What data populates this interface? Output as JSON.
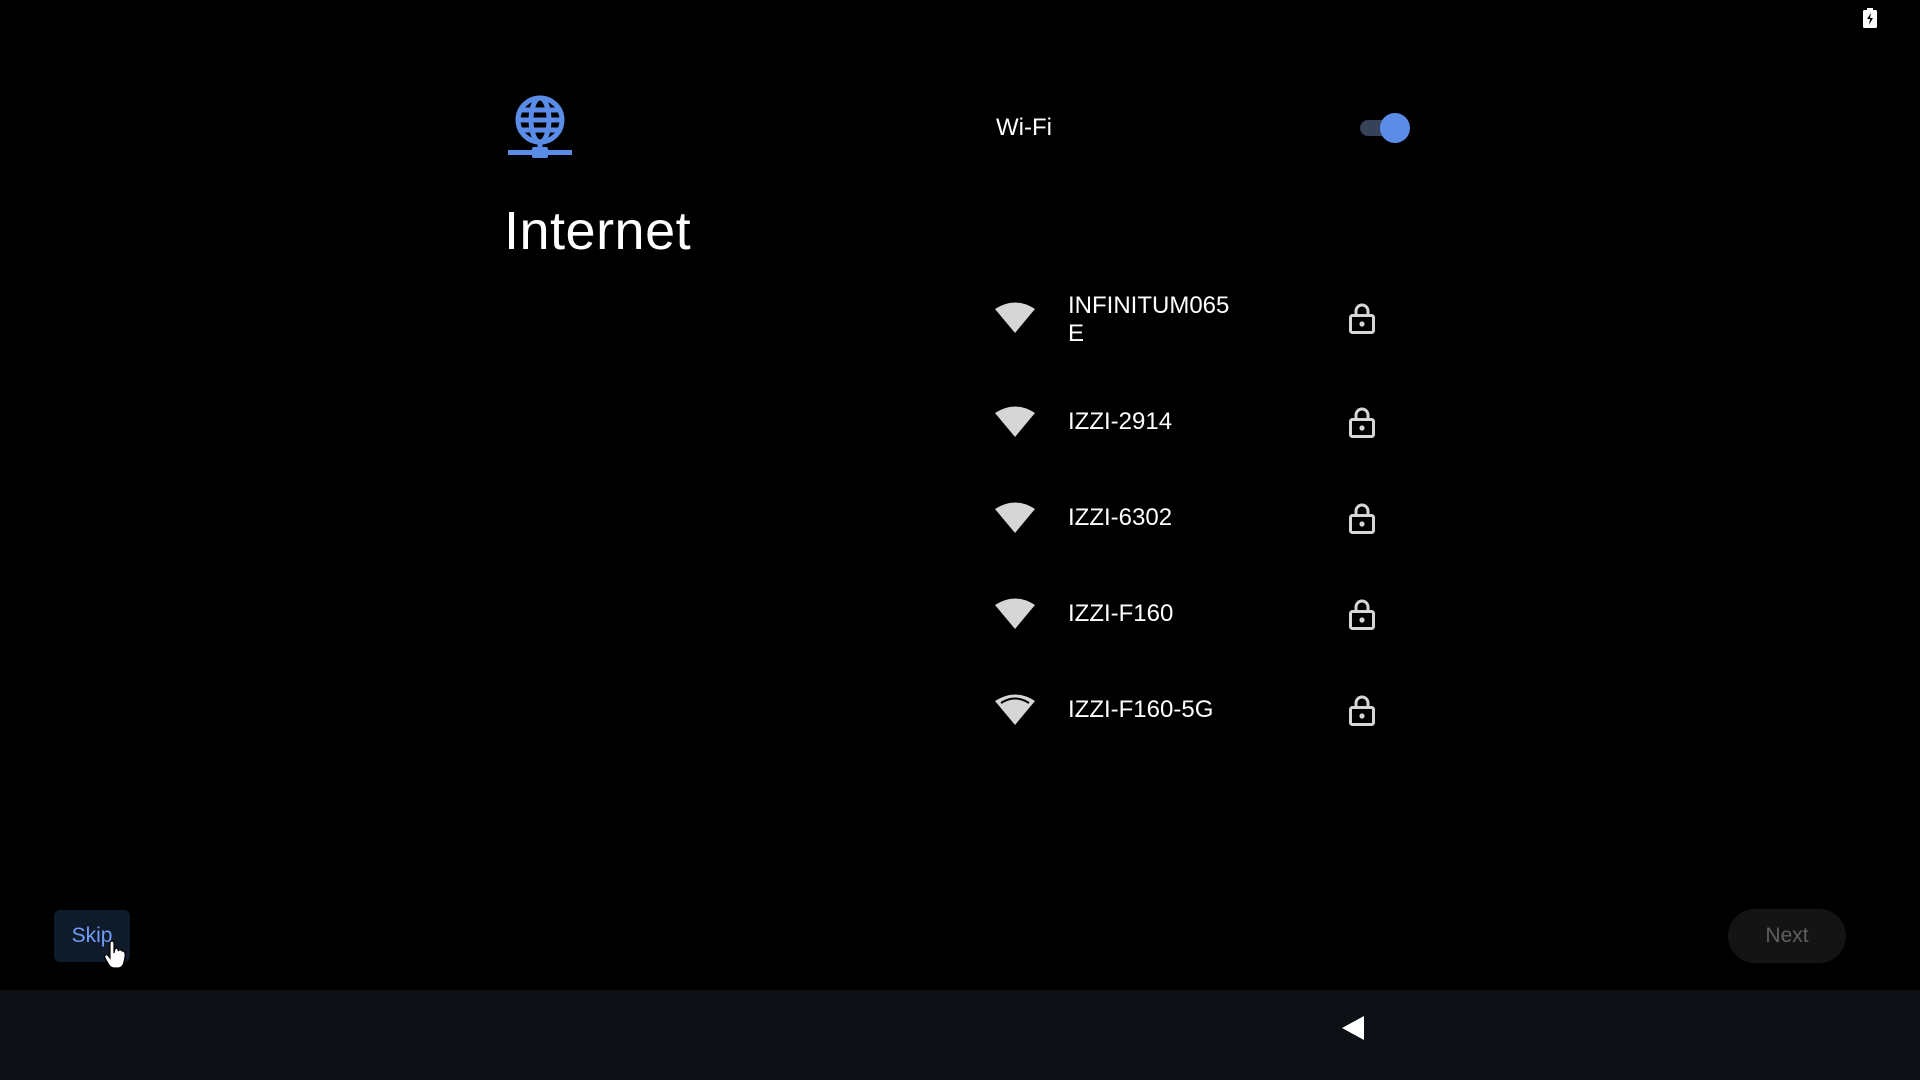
{
  "status_bar": {
    "icons": [
      "battery-icon"
    ]
  },
  "header": {
    "icon": "globe-network-icon",
    "title": "Internet"
  },
  "wifi": {
    "label": "Wi-Fi",
    "enabled": true,
    "networks": [
      {
        "ssid": "INFINITUM065E",
        "signal_icon": "wifi-signal-icon",
        "secured": true,
        "lock_icon": "lock-icon"
      },
      {
        "ssid": "IZZI-2914",
        "signal_icon": "wifi-signal-icon",
        "secured": true,
        "lock_icon": "lock-icon"
      },
      {
        "ssid": "IZZI-6302",
        "signal_icon": "wifi-signal-icon",
        "secured": true,
        "lock_icon": "lock-icon"
      },
      {
        "ssid": "IZZI-F160",
        "signal_icon": "wifi-signal-icon",
        "secured": true,
        "lock_icon": "lock-icon"
      },
      {
        "ssid": "IZZI-F160-5G",
        "signal_icon": "wifi-signal-icon",
        "secured": true,
        "lock_icon": "lock-icon"
      }
    ]
  },
  "footer": {
    "skip_label": "Skip",
    "next_label": "Next",
    "next_enabled": false
  },
  "navbar": {
    "back_icon": "back-triangle-icon"
  },
  "colors": {
    "accent": "#5b8ce8",
    "skip_text": "#6f9cf5",
    "background": "#000000",
    "navbar": "#0c1014"
  }
}
